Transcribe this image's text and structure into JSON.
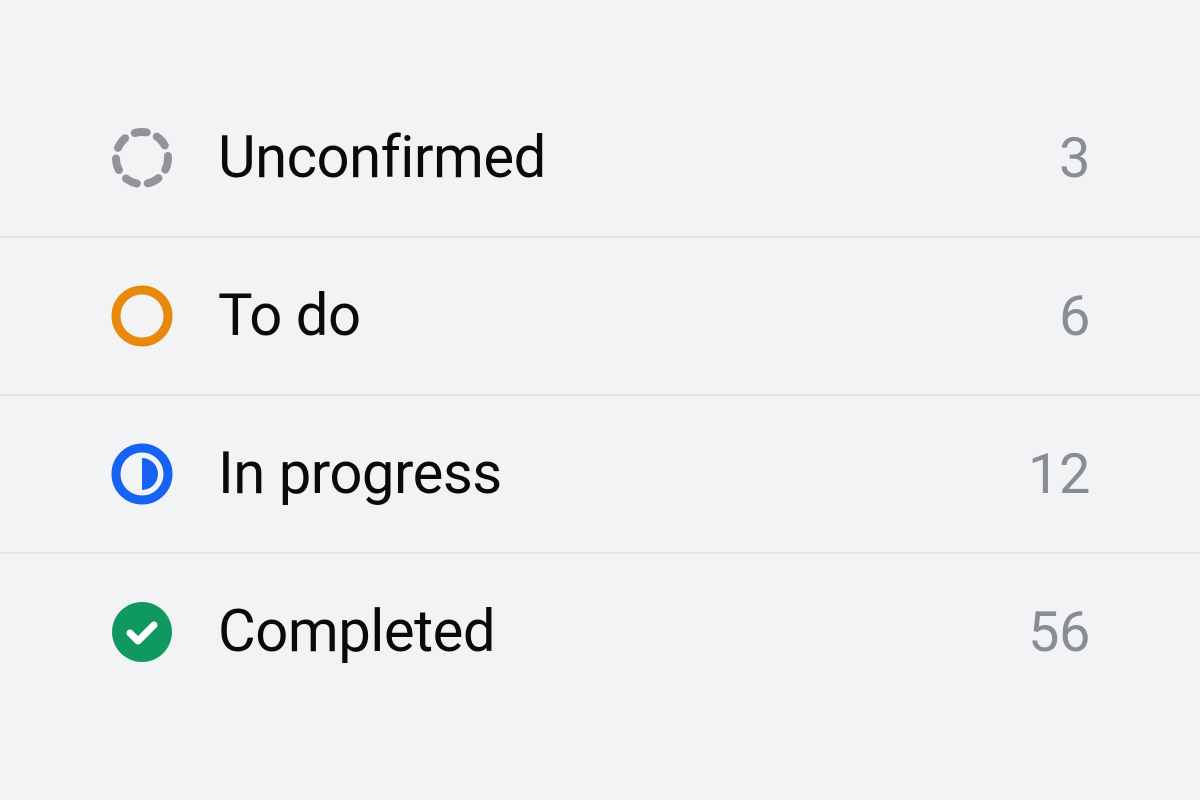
{
  "statuses": [
    {
      "id": "unconfirmed",
      "label": "Unconfirmed",
      "count": "3",
      "icon": "dashed-circle",
      "color": "#939399"
    },
    {
      "id": "todo",
      "label": "To do",
      "count": "6",
      "icon": "ring",
      "color": "#e8890d"
    },
    {
      "id": "in-progress",
      "label": "In progress",
      "count": "12",
      "icon": "half-circle",
      "color": "#1662f2"
    },
    {
      "id": "completed",
      "label": "Completed",
      "count": "56",
      "icon": "check-filled",
      "color": "#0f9960"
    }
  ]
}
